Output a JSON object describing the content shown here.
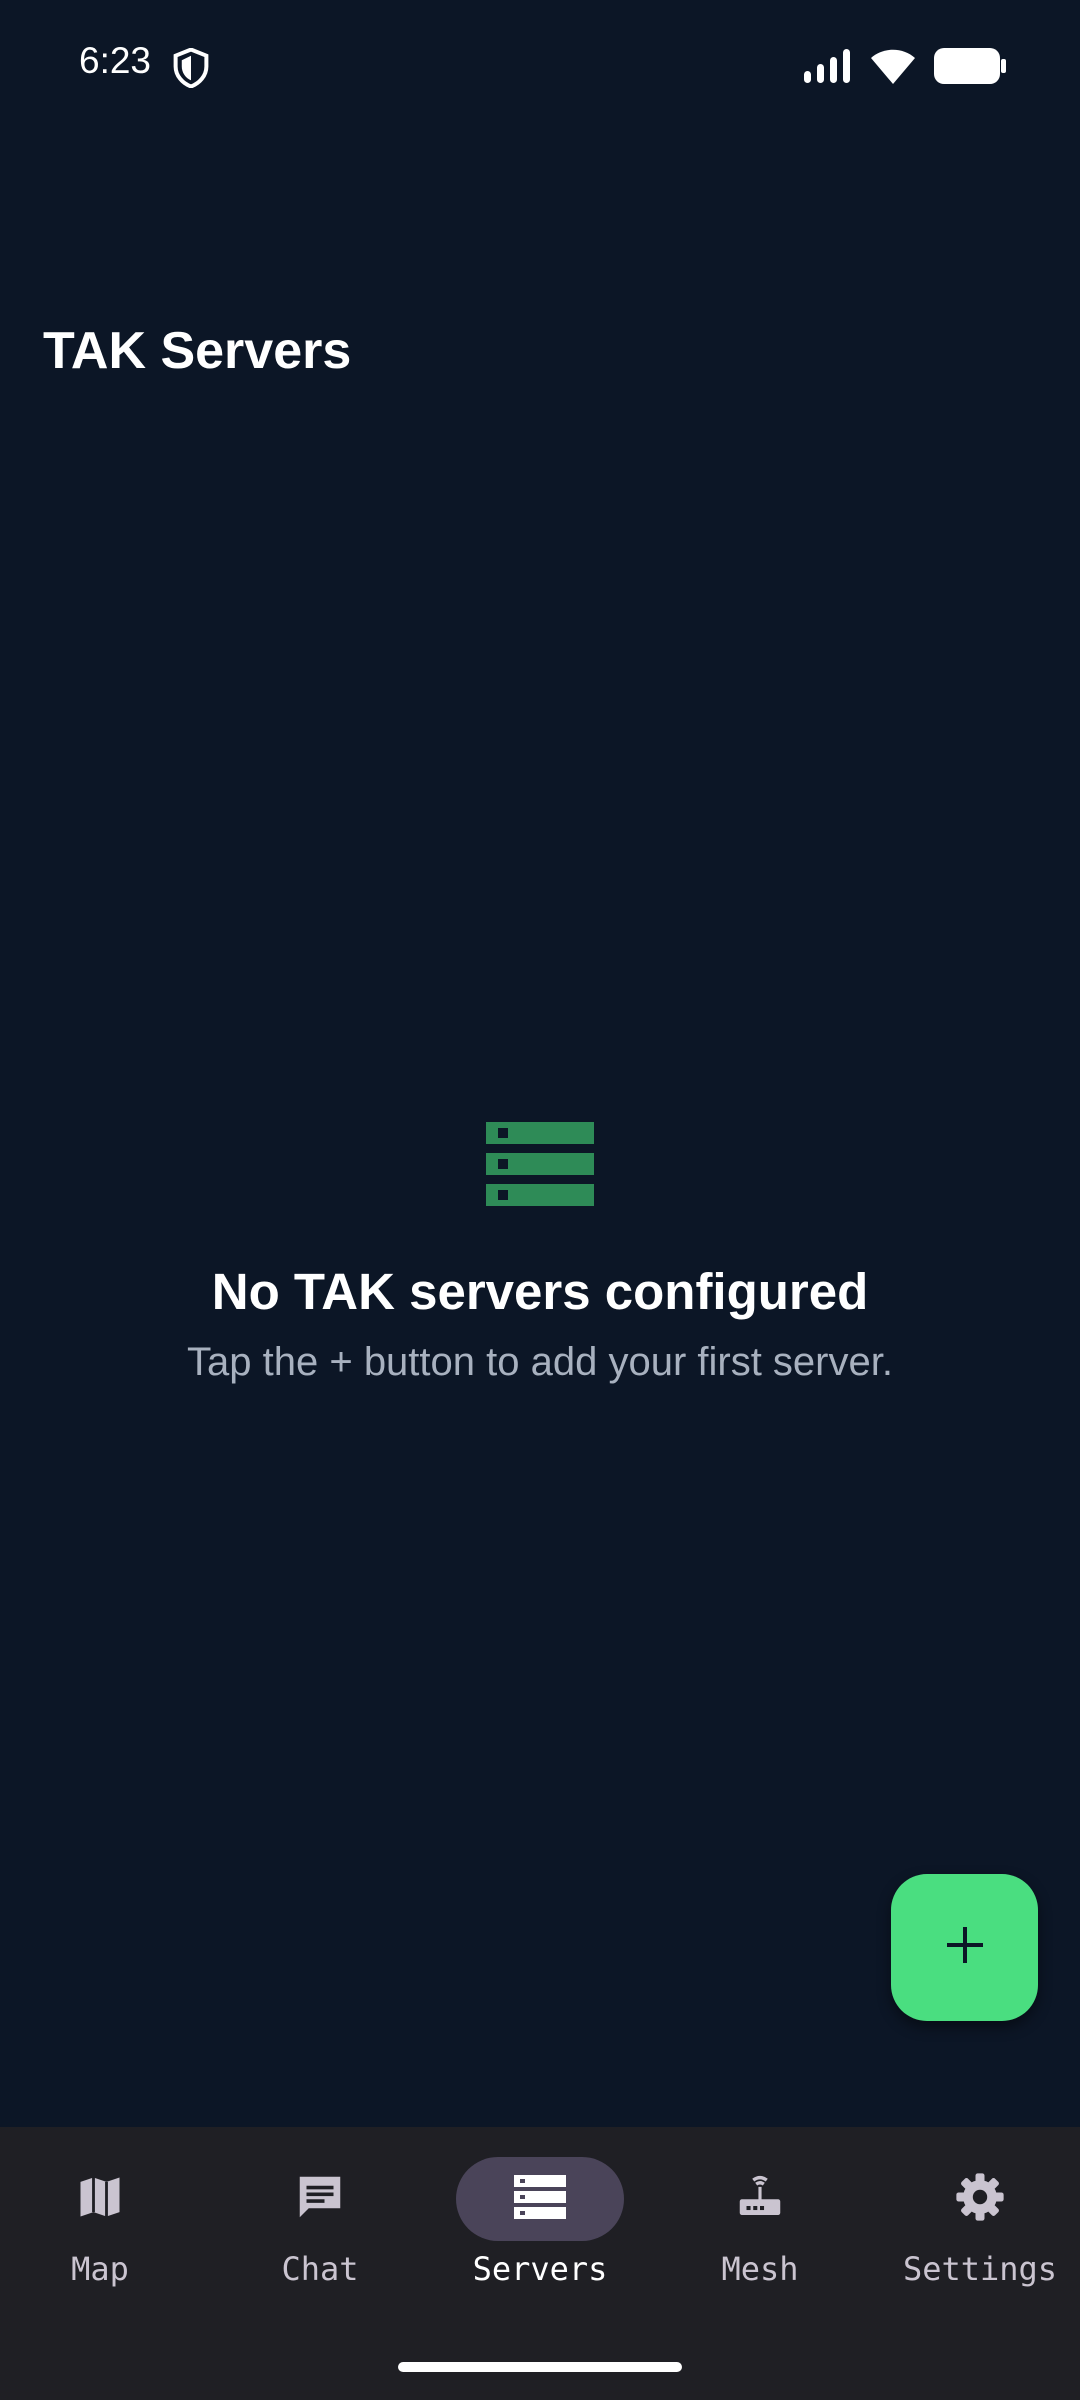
{
  "status_bar": {
    "time": "6:23",
    "icons": [
      "shield-icon",
      "signal-icon",
      "wifi-icon",
      "battery-icon"
    ]
  },
  "header": {
    "title": "TAK Servers"
  },
  "empty_state": {
    "icon": "server-stack-icon",
    "title": "No TAK servers configured",
    "subtitle": "Tap the + button to add your first server."
  },
  "fab": {
    "icon": "plus-icon"
  },
  "bottom_nav": {
    "items": [
      {
        "label": "Map",
        "icon": "map-icon",
        "active": false
      },
      {
        "label": "Chat",
        "icon": "chat-icon",
        "active": false
      },
      {
        "label": "Servers",
        "icon": "servers-icon",
        "active": true
      },
      {
        "label": "Mesh",
        "icon": "router-icon",
        "active": false
      },
      {
        "label": "Settings",
        "icon": "gear-icon",
        "active": false
      }
    ]
  },
  "colors": {
    "background": "#0c1626",
    "accent": "#4ade80",
    "icon_green": "#2e8b57",
    "nav_background": "#1f1f24",
    "nav_active_pill": "#4a4459"
  }
}
